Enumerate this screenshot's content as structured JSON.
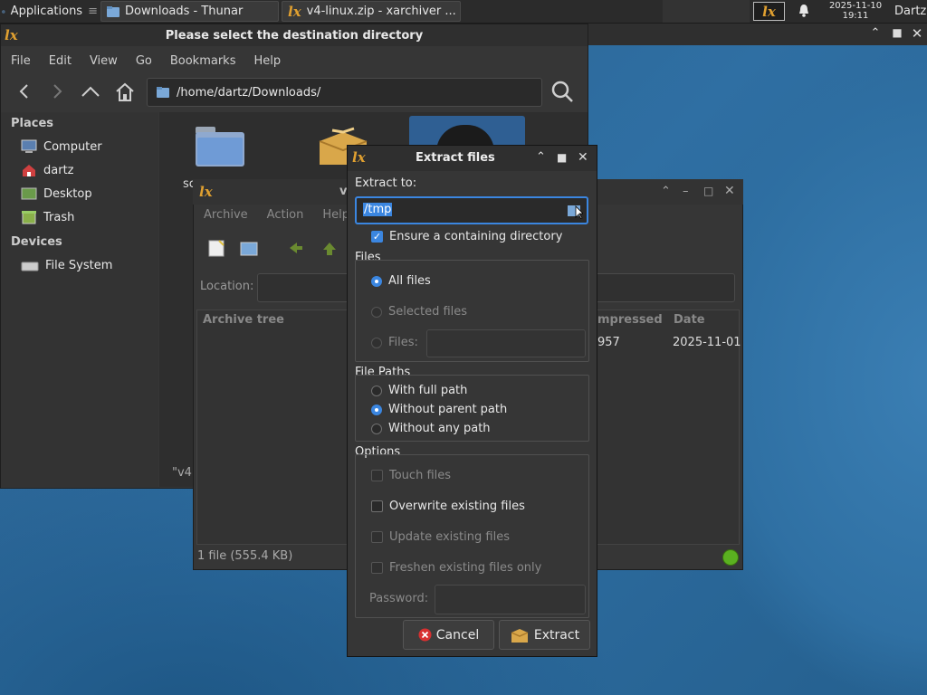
{
  "panel": {
    "applications_label": "Applications",
    "tasks": [
      {
        "label": "Downloads - Thunar"
      },
      {
        "label": "v4-linux.zip - xarchiver ..."
      }
    ],
    "clock_date": "2025-11-10",
    "clock_time": "19:11",
    "user": "Dartz"
  },
  "dest_window": {
    "title": "Please select the destination directory",
    "menu": [
      "File",
      "Edit",
      "View",
      "Go",
      "Bookmarks",
      "Help"
    ],
    "path": "/home/dartz/Downloads/",
    "places_header": "Places",
    "places": [
      "Computer",
      "dartz",
      "Desktop",
      "Trash"
    ],
    "devices_header": "Devices",
    "devices": [
      "File System"
    ],
    "file_label_partial": "sc",
    "status_partial": "\"v4"
  },
  "xarchiver": {
    "title_partial": "v",
    "menu": [
      "Archive",
      "Action",
      "Help"
    ],
    "location_label": "Location:",
    "tree_header": "Archive tree",
    "col_compressed": "mpressed",
    "col_date": "Date",
    "row_compressed": "957",
    "row_date": "2025-11-01",
    "status": "1 file  (555.4 KB)"
  },
  "extract": {
    "title": "Extract files",
    "extract_to_label": "Extract to:",
    "extract_to_value": "/tmp",
    "ensure_dir_label": "Ensure a containing directory",
    "files_header": "Files",
    "all_files": "All files",
    "selected_files": "Selected files",
    "files_label": "Files:",
    "paths_header": "File Paths",
    "with_full_path": "With full path",
    "without_parent_path": "Without parent path",
    "without_any_path": "Without any path",
    "options_header": "Options",
    "touch_files": "Touch files",
    "overwrite_files": "Overwrite existing files",
    "update_files": "Update existing files",
    "freshen_files": "Freshen existing files only",
    "password_label": "Password:",
    "cancel": "Cancel",
    "extract": "Extract"
  }
}
